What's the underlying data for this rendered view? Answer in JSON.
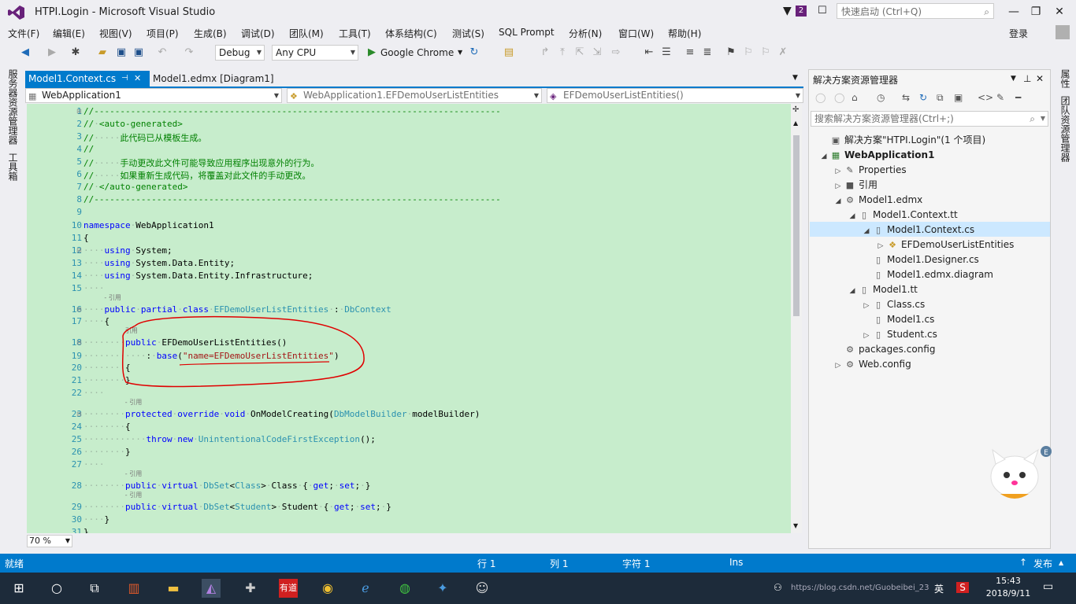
{
  "window": {
    "title": "HTPI.Login - Microsoft Visual Studio",
    "notif_count": "2",
    "quick_launch_placeholder": "快速启动 (Ctrl+Q)",
    "login": "登录"
  },
  "menu": [
    "文件(F)",
    "编辑(E)",
    "视图(V)",
    "项目(P)",
    "生成(B)",
    "调试(D)",
    "团队(M)",
    "工具(T)",
    "体系结构(C)",
    "测试(S)",
    "SQL Prompt",
    "分析(N)",
    "窗口(W)",
    "帮助(H)"
  ],
  "toolbar": {
    "config": "Debug",
    "platform": "Any CPU",
    "run_target": "Google Chrome"
  },
  "left_tabs": [
    "服务器资源管理器",
    "工具箱"
  ],
  "right_tabs": [
    "属性",
    "团队资源管理器"
  ],
  "doc_tabs": [
    {
      "label": "Model1.Context.cs",
      "active": true
    },
    {
      "label": "Model1.edmx [Diagram1]",
      "active": false
    }
  ],
  "nav": {
    "project": "WebApplication1",
    "type": "WebApplication1.EFDemoUserListEntities",
    "member": "EFDemoUserListEntities()"
  },
  "code": {
    "lines": [
      {
        "n": "1",
        "t": "//------------------------------------------------------------------------------",
        "c": "cm"
      },
      {
        "n": "2",
        "t": "// <auto-generated>",
        "c": "cm"
      },
      {
        "n": "3",
        "t": "//     此代码已从模板生成。",
        "c": "cm"
      },
      {
        "n": "4",
        "t": "//",
        "c": "cm"
      },
      {
        "n": "5",
        "t": "//     手动更改此文件可能导致应用程序出现意外的行为。",
        "c": "cm"
      },
      {
        "n": "6",
        "t": "//     如果重新生成代码，将覆盖对此文件的手动更改。",
        "c": "cm"
      },
      {
        "n": "7",
        "t": "// </auto-generated>",
        "c": "cm"
      },
      {
        "n": "8",
        "t": "//------------------------------------------------------------------------------",
        "c": "cm"
      },
      {
        "n": "9",
        "t": "",
        "c": ""
      },
      {
        "n": "10",
        "t": "namespace WebApplication1",
        "c": "ns"
      },
      {
        "n": "11",
        "t": "{",
        "c": ""
      },
      {
        "n": "12",
        "t": "    using System;",
        "c": "using"
      },
      {
        "n": "13",
        "t": "    using System.Data.Entity;",
        "c": "using"
      },
      {
        "n": "14",
        "t": "    using System.Data.Entity.Infrastructure;",
        "c": "using"
      },
      {
        "n": "15",
        "t": "    ",
        "c": ""
      },
      {
        "n": "16",
        "t": "    public partial class EFDemoUserListEntities : DbContext",
        "c": "class"
      },
      {
        "n": "17",
        "t": "    {",
        "c": ""
      },
      {
        "n": "18",
        "t": "        public EFDemoUserListEntities()",
        "c": "ctor"
      },
      {
        "n": "19",
        "t": "            : base(\"name=EFDemoUserListEntities\")",
        "c": "base"
      },
      {
        "n": "20",
        "t": "        {",
        "c": ""
      },
      {
        "n": "21",
        "t": "        }",
        "c": ""
      },
      {
        "n": "22",
        "t": "    ",
        "c": ""
      },
      {
        "n": "23",
        "t": "        protected override void OnModelCreating(DbModelBuilder modelBuilder)",
        "c": "method"
      },
      {
        "n": "24",
        "t": "        {",
        "c": ""
      },
      {
        "n": "25",
        "t": "            throw new UnintentionalCodeFirstException();",
        "c": "throw"
      },
      {
        "n": "26",
        "t": "        }",
        "c": ""
      },
      {
        "n": "27",
        "t": "    ",
        "c": ""
      },
      {
        "n": "28",
        "t": "        public virtual DbSet<Class> Class { get; set; }",
        "c": "dbset1"
      },
      {
        "n": "29",
        "t": "        public virtual DbSet<Student> Student { get; set; }",
        "c": "dbset2"
      },
      {
        "n": "30",
        "t": "    }",
        "c": ""
      },
      {
        "n": "31",
        "t": "}",
        "c": ""
      }
    ],
    "lens_text": "- 引用",
    "lens_text2": "引用",
    "zoom": "70 %"
  },
  "solution_explorer": {
    "title": "解决方案资源管理器",
    "search_placeholder": "搜索解决方案资源管理器(Ctrl+;)",
    "items": [
      {
        "label": "解决方案\"HTPI.Login\"(1 个项目)",
        "exp": "",
        "icon": "solution-icon"
      },
      {
        "label": "WebApplication1",
        "exp": "◢",
        "icon": "project-icon"
      },
      {
        "label": "Properties",
        "exp": "▷",
        "icon": "wrench-icon"
      },
      {
        "label": "引用",
        "exp": "▷",
        "icon": "references-icon"
      },
      {
        "label": "Model1.edmx",
        "exp": "◢",
        "icon": "edmx-icon"
      },
      {
        "label": "Model1.Context.tt",
        "exp": "◢",
        "icon": "file-icon"
      },
      {
        "label": "Model1.Context.cs",
        "exp": "◢",
        "icon": "file-icon"
      },
      {
        "label": "EFDemoUserListEntities",
        "exp": "▷",
        "icon": "class-icon"
      },
      {
        "label": "Model1.Designer.cs",
        "exp": "",
        "icon": "file-icon"
      },
      {
        "label": "Model1.edmx.diagram",
        "exp": "",
        "icon": "file-icon"
      },
      {
        "label": "Model1.tt",
        "exp": "◢",
        "icon": "file-icon"
      },
      {
        "label": "Class.cs",
        "exp": "▷",
        "icon": "file-icon"
      },
      {
        "label": "Model1.cs",
        "exp": "",
        "icon": "file-icon"
      },
      {
        "label": "Student.cs",
        "exp": "▷",
        "icon": "file-icon"
      },
      {
        "label": "packages.config",
        "exp": "",
        "icon": "config-icon"
      },
      {
        "label": "Web.config",
        "exp": "▷",
        "icon": "config-icon"
      }
    ]
  },
  "status": {
    "ready": "就绪",
    "row": "行 1",
    "col": "列 1",
    "char": "字符 1",
    "ins": "Ins",
    "publish": "发布"
  },
  "taskbar": {
    "time": "15:43",
    "date": "2018/9/11",
    "lang": "英",
    "youdao": "有道",
    "watermark": "https://blog.csdn.net/Guobeibei_23"
  },
  "colors": {
    "accent": "#007acc",
    "editor_bg": "#c7edcc",
    "keyword": "#0000ff",
    "type": "#2b91af",
    "comment": "#008000",
    "string": "#a31515",
    "annotation": "#e00000"
  }
}
